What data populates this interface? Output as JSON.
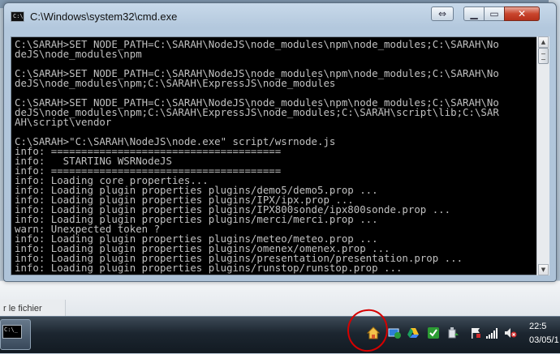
{
  "window": {
    "title": "C:\\Windows\\system32\\cmd.exe",
    "buttons": {
      "move": "⇔",
      "minimize": "▁",
      "maximize": "▭",
      "close": "✕"
    }
  },
  "console": {
    "lines": [
      "C:\\SARAH>SET NODE_PATH=C:\\SARAH\\NodeJS\\node_modules\\npm\\node_modules;C:\\SARAH\\No",
      "deJS\\node_modules\\npm",
      "",
      "C:\\SARAH>SET NODE_PATH=C:\\SARAH\\NodeJS\\node_modules\\npm\\node_modules;C:\\SARAH\\No",
      "deJS\\node_modules\\npm;C:\\SARAH\\ExpressJS\\node_modules",
      "",
      "C:\\SARAH>SET NODE_PATH=C:\\SARAH\\NodeJS\\node_modules\\npm\\node_modules;C:\\SARAH\\No",
      "deJS\\node_modules\\npm;C:\\SARAH\\ExpressJS\\node_modules;C:\\SARAH\\script\\lib;C:\\SAR",
      "AH\\script\\vendor",
      "",
      "C:\\SARAH>\"C:\\SARAH\\NodeJS\\node.exe\" script/wsrnode.js",
      "info: ======================================",
      "info:   STARTING WSRNodeJS",
      "info: ======================================",
      "info: Loading core properties...",
      "info: Loading plugin properties plugins/demo5/demo5.prop ...",
      "info: Loading plugin properties plugins/IPX/ipx.prop ...",
      "info: Loading plugin properties plugins/IPX800sonde/ipx800sonde.prop ...",
      "info: Loading plugin properties plugins/merci/merci.prop ...",
      "warn: Unexpected token ?",
      "info: Loading plugin properties plugins/meteo/meteo.prop ...",
      "info: Loading plugin properties plugins/omenex/omenex.prop ...",
      "info: Loading plugin properties plugins/presentation/presentation.prop ...",
      "info: Loading plugin properties plugins/runstop/runstop.prop ..."
    ]
  },
  "background": {
    "partial_label": "r le fichier"
  },
  "taskbar": {
    "clock_time": "22:5",
    "clock_date": "03/05/1"
  },
  "colors": {
    "console_bg": "#000000",
    "console_text": "#c0c0c0",
    "annotation": "#d60000",
    "close_button": "#c9452d"
  }
}
